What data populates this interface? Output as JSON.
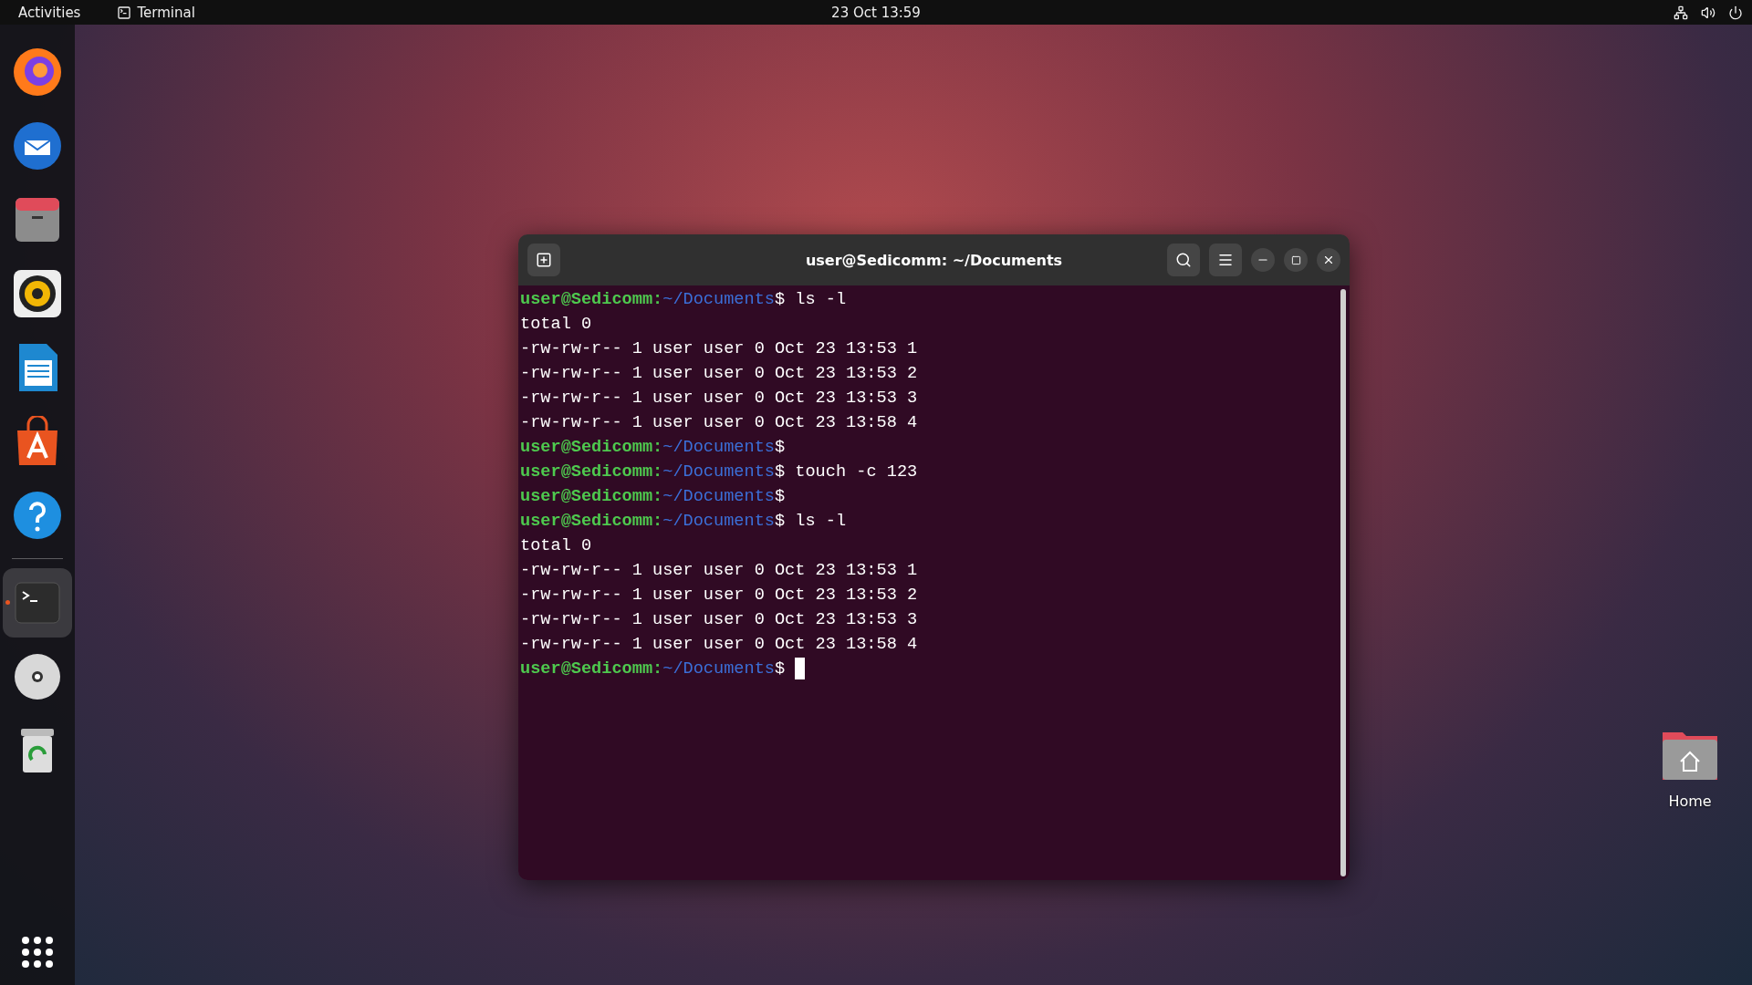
{
  "top_bar": {
    "activities": "Activities",
    "app": "Terminal",
    "clock": "23 Oct  13:59"
  },
  "dock": {
    "items": [
      {
        "kind": "browser",
        "running": false
      },
      {
        "kind": "mail",
        "running": false
      },
      {
        "kind": "files",
        "running": false
      },
      {
        "kind": "music",
        "running": false
      },
      {
        "kind": "writer",
        "running": false
      },
      {
        "kind": "store",
        "running": false
      },
      {
        "kind": "help",
        "running": false
      },
      {
        "kind": "terminal",
        "running": true
      },
      {
        "kind": "disc",
        "running": false
      },
      {
        "kind": "trash",
        "running": false
      }
    ]
  },
  "terminal": {
    "title": "user@Sedicomm: ~/Documents",
    "lines": [
      {
        "kind": "prompt",
        "user": "user@Sedicomm:",
        "path": "~/Documents",
        "sign": "$",
        "command": "ls -l",
        "cursor": false
      },
      {
        "kind": "output",
        "text": "total 0"
      },
      {
        "kind": "output",
        "text": "-rw-rw-r-- 1 user user 0 Oct 23 13:53 1"
      },
      {
        "kind": "output",
        "text": "-rw-rw-r-- 1 user user 0 Oct 23 13:53 2"
      },
      {
        "kind": "output",
        "text": "-rw-rw-r-- 1 user user 0 Oct 23 13:53 3"
      },
      {
        "kind": "output",
        "text": "-rw-rw-r-- 1 user user 0 Oct 23 13:58 4"
      },
      {
        "kind": "prompt",
        "user": "user@Sedicomm:",
        "path": "~/Documents",
        "sign": "$",
        "cursor": false
      },
      {
        "kind": "prompt",
        "user": "user@Sedicomm:",
        "path": "~/Documents",
        "sign": "$",
        "command": "touch -c 123",
        "cursor": false
      },
      {
        "kind": "prompt",
        "user": "user@Sedicomm:",
        "path": "~/Documents",
        "sign": "$",
        "cursor": false
      },
      {
        "kind": "prompt",
        "user": "user@Sedicomm:",
        "path": "~/Documents",
        "sign": "$",
        "command": "ls -l",
        "cursor": false
      },
      {
        "kind": "output",
        "text": "total 0"
      },
      {
        "kind": "output",
        "text": "-rw-rw-r-- 1 user user 0 Oct 23 13:53 1"
      },
      {
        "kind": "output",
        "text": "-rw-rw-r-- 1 user user 0 Oct 23 13:53 2"
      },
      {
        "kind": "output",
        "text": "-rw-rw-r-- 1 user user 0 Oct 23 13:53 3"
      },
      {
        "kind": "output",
        "text": "-rw-rw-r-- 1 user user 0 Oct 23 13:58 4"
      },
      {
        "kind": "prompt",
        "user": "user@Sedicomm:",
        "path": "~/Documents",
        "sign": "$",
        "cursor": true
      }
    ]
  },
  "desktop_icons": [
    {
      "label": "Home"
    }
  ]
}
